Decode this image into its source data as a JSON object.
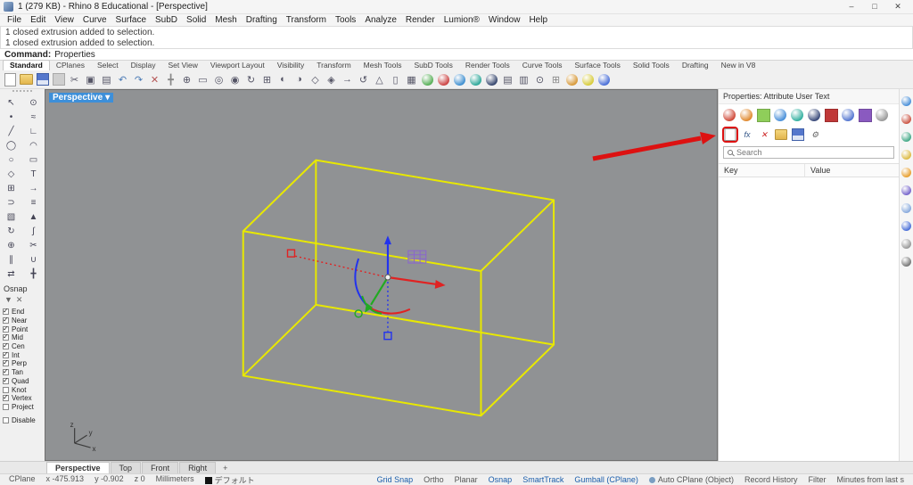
{
  "colors": {
    "accent_blue": "#3d8fd9",
    "selection_yellow": "#e8e800",
    "annotation_red": "#dd1111",
    "gumball_red": "#e02222",
    "gumball_green": "#22aa22",
    "gumball_blue": "#2233ee",
    "viewport_gray": "#909294",
    "status_active_blue": "#1a5dab"
  },
  "window": {
    "title": "1 (279 KB) - Rhino 8 Educational - [Perspective]",
    "controls": {
      "minimize": "–",
      "maximize": "□",
      "close": "✕"
    }
  },
  "menu_bar": {
    "items": [
      "File",
      "Edit",
      "View",
      "Curve",
      "Surface",
      "SubD",
      "Solid",
      "Mesh",
      "Drafting",
      "Transform",
      "Tools",
      "Analyze",
      "Render",
      "Lumion®",
      "Window",
      "Help"
    ]
  },
  "command_history": {
    "lines": [
      "1 closed extrusion added to selection.",
      "1 closed extrusion added to selection."
    ]
  },
  "command_line": {
    "prompt": "Command:",
    "value": "Properties"
  },
  "toolbar_tabs": {
    "items": [
      {
        "label": "Standard",
        "active": true
      },
      {
        "label": "CPlanes"
      },
      {
        "label": "Select"
      },
      {
        "label": "Display"
      },
      {
        "label": "Set View"
      },
      {
        "label": "Viewport Layout"
      },
      {
        "label": "Visibility"
      },
      {
        "label": "Transform"
      },
      {
        "label": "Mesh Tools"
      },
      {
        "label": "SubD Tools"
      },
      {
        "label": "Render Tools"
      },
      {
        "label": "Curve Tools"
      },
      {
        "label": "Surface Tools"
      },
      {
        "label": "Solid Tools"
      },
      {
        "label": "Drafting"
      },
      {
        "label": "New in V8"
      }
    ]
  },
  "toolbar_icons": {
    "items": [
      {
        "name": "new-file-icon",
        "shape": "sheet"
      },
      {
        "name": "open-file-icon",
        "shape": "folder"
      },
      {
        "name": "save-icon",
        "shape": "disk"
      },
      {
        "name": "print-icon",
        "shape": "flat",
        "c": "#cfcfcf"
      },
      {
        "name": "cut-icon",
        "glyph": "✂",
        "color": "#556"
      },
      {
        "name": "copy-icon",
        "glyph": "▣",
        "color": "#556"
      },
      {
        "name": "paste-icon",
        "glyph": "▤",
        "color": "#556"
      },
      {
        "name": "undo-icon",
        "glyph": "↶",
        "color": "#4a7ab5"
      },
      {
        "name": "redo-icon",
        "glyph": "↷",
        "color": "#4a7ab5"
      },
      {
        "name": "delete-icon",
        "glyph": "✕",
        "color": "#b55555"
      },
      {
        "name": "pan-icon",
        "glyph": "╋",
        "color": "#888"
      },
      {
        "name": "zoom-dynamic-icon",
        "glyph": "⊕",
        "color": "#556"
      },
      {
        "name": "zoom-window-icon",
        "glyph": "▭",
        "color": "#556"
      },
      {
        "name": "zoom-extents-icon",
        "glyph": "◎",
        "color": "#556"
      },
      {
        "name": "zoom-selected-icon",
        "glyph": "◉",
        "color": "#556"
      },
      {
        "name": "rotate-view-icon",
        "glyph": "↻",
        "color": "#556"
      },
      {
        "name": "named-view-icon",
        "glyph": "⊞",
        "color": "#556"
      },
      {
        "name": "display-mode-icon",
        "glyph": "◐",
        "color": "#556"
      },
      {
        "name": "shaded-view-icon",
        "glyph": "◑",
        "color": "#556"
      },
      {
        "name": "wireframe-view-icon",
        "glyph": "◇",
        "color": "#556"
      },
      {
        "name": "ghosted-view-icon",
        "glyph": "◈",
        "color": "#556"
      },
      {
        "name": "move-icon",
        "glyph": "→",
        "color": "#556"
      },
      {
        "name": "rotate-icon",
        "glyph": "↺",
        "color": "#556"
      },
      {
        "name": "scale-icon",
        "glyph": "△",
        "color": "#556"
      },
      {
        "name": "mirror-icon",
        "glyph": "▯",
        "color": "#556"
      },
      {
        "name": "array-icon",
        "glyph": "▦",
        "color": "#556"
      },
      {
        "name": "sphere-render-icon",
        "shape": "ball",
        "c": "#58b058"
      },
      {
        "name": "render-icon",
        "shape": "ball",
        "c": "#cc4444"
      },
      {
        "name": "render-preview-icon",
        "shape": "ball",
        "c": "#3f8fd0"
      },
      {
        "name": "environment-icon",
        "shape": "ball",
        "c": "#2fa89a"
      },
      {
        "name": "raytrace-icon",
        "shape": "ball",
        "c": "#37476e"
      },
      {
        "name": "layers-icon",
        "glyph": "▤",
        "color": "#556"
      },
      {
        "name": "properties-icon",
        "glyph": "▥",
        "color": "#556"
      },
      {
        "name": "object-snap-icon",
        "glyph": "⊙",
        "color": "#556"
      },
      {
        "name": "grid-options-icon",
        "glyph": "⊞",
        "color": "#888"
      },
      {
        "name": "material-ball-icon",
        "shape": "ball",
        "c": "#d89a3a"
      },
      {
        "name": "texture-ball-icon",
        "shape": "ball",
        "c": "#d8cc3a"
      },
      {
        "name": "help-ball-icon",
        "shape": "ball",
        "c": "#4a6fd8"
      }
    ]
  },
  "left_toolbar": {
    "items": [
      {
        "name": "select-icon",
        "glyph": "↖"
      },
      {
        "name": "selection-filter-icon",
        "glyph": "⊙"
      },
      {
        "name": "point-icon",
        "glyph": "•"
      },
      {
        "name": "curve-icon",
        "glyph": "≈"
      },
      {
        "name": "line-icon",
        "glyph": "╱"
      },
      {
        "name": "polyline-icon",
        "glyph": "∟"
      },
      {
        "name": "circle-icon",
        "glyph": "◯"
      },
      {
        "name": "arc-icon",
        "glyph": "◠"
      },
      {
        "name": "ellipse-icon",
        "glyph": "○"
      },
      {
        "name": "rectangle-icon",
        "glyph": "▭"
      },
      {
        "name": "polygon-icon",
        "glyph": "◇"
      },
      {
        "name": "text-icon",
        "glyph": "T"
      },
      {
        "name": "points-on-icon",
        "glyph": "⊞"
      },
      {
        "name": "extend-icon",
        "glyph": "→"
      },
      {
        "name": "fillet-icon",
        "glyph": "⊃"
      },
      {
        "name": "offset-icon",
        "glyph": "≡"
      },
      {
        "name": "surface-icon",
        "glyph": "▧"
      },
      {
        "name": "extrude-icon",
        "glyph": "▲"
      },
      {
        "name": "revolve-icon",
        "glyph": "↻"
      },
      {
        "name": "sweep-icon",
        "glyph": "∫"
      },
      {
        "name": "boolean-icon",
        "glyph": "⊕"
      },
      {
        "name": "trim-icon",
        "glyph": "✂"
      },
      {
        "name": "split-icon",
        "glyph": "∥"
      },
      {
        "name": "join-icon",
        "glyph": "∪"
      },
      {
        "name": "transform-icon",
        "glyph": "⇄"
      },
      {
        "name": "gumball-icon",
        "glyph": "╋"
      }
    ]
  },
  "osnap": {
    "title": "Osnap",
    "filter_glyph": "▼",
    "clear_glyph": "✕",
    "items": [
      {
        "label": "End",
        "checked": true
      },
      {
        "label": "Near",
        "checked": true
      },
      {
        "label": "Point",
        "checked": true
      },
      {
        "label": "Mid",
        "checked": true
      },
      {
        "label": "Cen",
        "checked": true
      },
      {
        "label": "Int",
        "checked": true
      },
      {
        "label": "Perp",
        "checked": true
      },
      {
        "label": "Tan",
        "checked": true
      },
      {
        "label": "Quad",
        "checked": true
      },
      {
        "label": "Knot",
        "checked": false
      },
      {
        "label": "Vertex",
        "checked": true
      },
      {
        "label": "Project",
        "checked": false
      },
      {
        "label": "Disable",
        "checked": false
      }
    ]
  },
  "viewport": {
    "label": "Perspective",
    "menu_glyph": "▾",
    "axis_labels": {
      "x": "x",
      "y": "y",
      "z": "z"
    }
  },
  "properties_panel": {
    "title": "Properties: Attribute User Text",
    "search_placeholder": "Search",
    "table": {
      "columns": [
        "Key",
        "Value"
      ],
      "rows": []
    },
    "category_icons": [
      {
        "name": "object-properties-icon",
        "shape": "ball",
        "c": "#d04a3a"
      },
      {
        "name": "material-properties-icon",
        "shape": "ball",
        "c": "#e08a30"
      },
      {
        "name": "texture-mapping-icon",
        "shape": "flat",
        "c": "#8fce5a"
      },
      {
        "name": "display-properties-icon",
        "shape": "ball",
        "c": "#4a90d9"
      },
      {
        "name": "edge-softening-icon",
        "shape": "ball",
        "c": "#35b0a0"
      },
      {
        "name": "thickness-icon",
        "shape": "ball",
        "c": "#3a4a7a"
      },
      {
        "name": "dimension-style-icon",
        "shape": "flat",
        "c": "#c03838"
      },
      {
        "name": "isocurve-density-icon",
        "shape": "ball",
        "c": "#5577d0"
      },
      {
        "name": "attribute-user-text-icon",
        "shape": "flat",
        "c": "#8a5ac0"
      },
      {
        "name": "more-properties-icon",
        "shape": "ball",
        "c": "#9a9a9a"
      }
    ],
    "action_icons": [
      {
        "name": "add-key-value-icon",
        "glyph": "✱",
        "color": "#cc2222",
        "shape": "doc",
        "boxed": true
      },
      {
        "name": "attach-function-icon",
        "glyph": "fx",
        "color": "#335588"
      },
      {
        "name": "delete-key-icon",
        "glyph": "✕",
        "color": "#cc2222"
      },
      {
        "name": "import-keys-icon",
        "shape": "folder"
      },
      {
        "name": "export-keys-icon",
        "shape": "disk"
      },
      {
        "name": "options-gear-icon",
        "glyph": "⚙",
        "color": "#666"
      }
    ]
  },
  "right_strip": {
    "items": [
      {
        "name": "panel-display-icon",
        "c": "#4a90d9"
      },
      {
        "name": "panel-render-icon",
        "c": "#cc5544"
      },
      {
        "name": "panel-material-icon",
        "c": "#44aa88"
      },
      {
        "name": "panel-lighting-icon",
        "c": "#ddbb44"
      },
      {
        "name": "panel-sun-icon",
        "c": "#e8a030"
      },
      {
        "name": "panel-libraries-icon",
        "c": "#7766cc"
      },
      {
        "name": "panel-notes-icon",
        "c": "#88aadd"
      },
      {
        "name": "panel-help-icon",
        "c": "#4a6fd8"
      },
      {
        "name": "panel-web-icon",
        "c": "#999999"
      },
      {
        "name": "panel-macro-icon",
        "c": "#777777"
      }
    ]
  },
  "viewport_tabs": {
    "add_label": "+",
    "items": [
      {
        "label": "Perspective",
        "active": true,
        "name": "tab-perspective"
      },
      {
        "label": "Top",
        "name": "tab-top"
      },
      {
        "label": "Front",
        "name": "tab-front"
      },
      {
        "label": "Right",
        "name": "tab-right"
      }
    ]
  },
  "status_bar": {
    "left_items": [
      {
        "label": "CPlane",
        "name": "status-cplane"
      },
      {
        "label": "x -475.913",
        "name": "status-x-coordinate"
      },
      {
        "label": "y -0.902",
        "name": "status-y-coordinate"
      },
      {
        "label": "z 0",
        "name": "status-z-coordinate"
      },
      {
        "label": "Millimeters",
        "name": "status-units"
      },
      {
        "label": "デフォルト",
        "name": "status-layer",
        "swatch": true
      }
    ],
    "right_items": [
      {
        "label": "Grid Snap",
        "active": true,
        "name": "toggle-grid-snap"
      },
      {
        "label": "Ortho",
        "name": "toggle-ortho"
      },
      {
        "label": "Planar",
        "name": "toggle-planar"
      },
      {
        "label": "Osnap",
        "active": true,
        "name": "toggle-osnap"
      },
      {
        "label": "SmartTrack",
        "active": true,
        "name": "toggle-smarttrack"
      },
      {
        "label": "Gumball (CPlane)",
        "active": true,
        "name": "toggle-gumball"
      },
      {
        "label": "Auto CPlane (Object)",
        "dot": true,
        "name": "toggle-auto-cplane"
      },
      {
        "label": "Record History",
        "name": "toggle-record-history"
      },
      {
        "label": "Filter",
        "name": "status-filter"
      },
      {
        "label": "Minutes from last s",
        "name": "status-autosave"
      }
    ]
  }
}
